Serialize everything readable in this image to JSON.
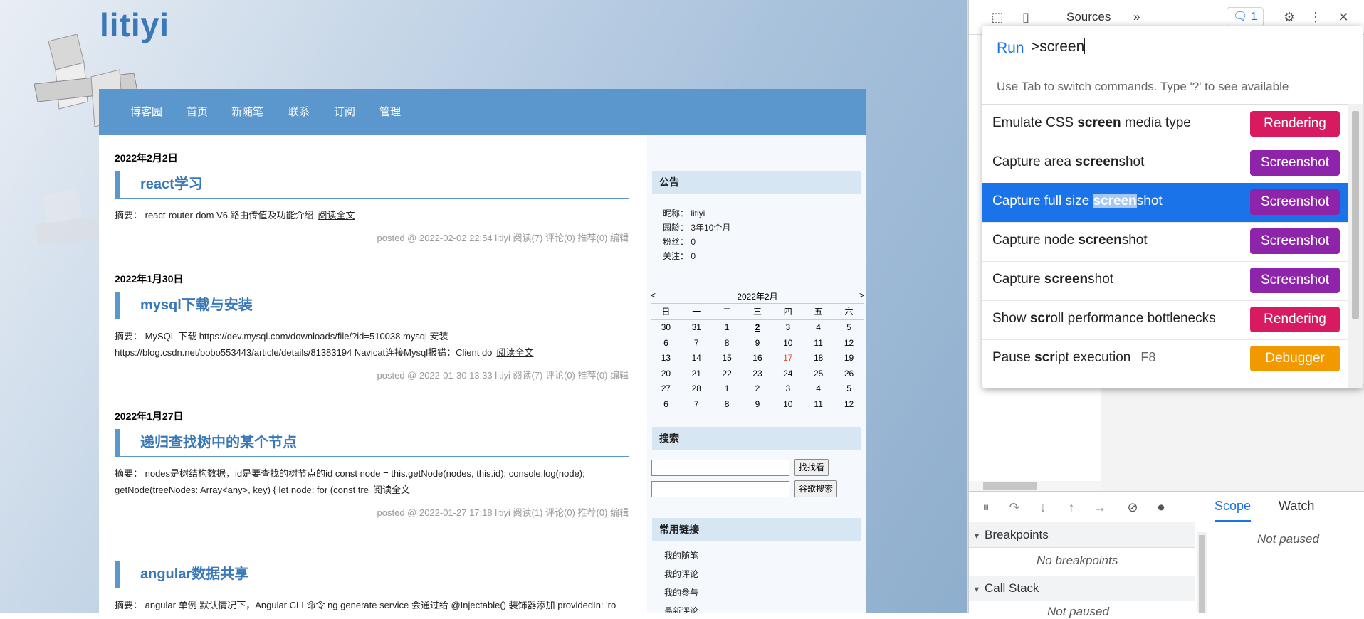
{
  "blog": {
    "title": "litiyi",
    "nav": [
      "博客园",
      "首页",
      "新随笔",
      "联系",
      "订阅",
      "管理"
    ],
    "posts": [
      {
        "date": "2022年2月2日",
        "title": "react学习",
        "summary": "摘要： react-router-dom V6 路由传值及功能介绍",
        "more": "阅读全文",
        "footer": "posted @ 2022-02-02 22:54 litiyi 阅读(7) 评论(0) 推荐(0) 编辑"
      },
      {
        "date": "2022年1月30日",
        "title": "mysql下载与安装",
        "summary": "摘要： MySQL 下载 https://dev.mysql.com/downloads/file/?id=510038 mysql 安装 https://blog.csdn.net/bobo553443/article/details/81383194 Navicat连接Mysql报错：Client do",
        "more": "阅读全文",
        "footer": "posted @ 2022-01-30 13:33 litiyi 阅读(7) 评论(0) 推荐(0) 编辑"
      },
      {
        "date": "2022年1月27日",
        "title": "递归查找树中的某个节点",
        "summary": "摘要： nodes是树结构数据，id是要查找的树节点的id const node = this.getNode(nodes, this.id); console.log(node); getNode(treeNodes: Array<any>, key) { let node; for (const tre",
        "more": "阅读全文",
        "footer": "posted @ 2022-01-27 17:18 litiyi 阅读(1) 评论(0) 推荐(0) 编辑"
      },
      {
        "date": "",
        "title": "angular数据共享",
        "summary": "摘要： angular 单例 默认情况下，Angular CLI 命令 ng generate service 会通过给 @Injectable() 装饰器添加 providedIn: 'ro",
        "more": "",
        "footer": ""
      }
    ],
    "sidebar": {
      "notice_title": "公告",
      "notice": [
        "昵称： litiyi",
        "园龄： 3年10个月",
        "粉丝： 0",
        "关注： 0"
      ],
      "calendar": {
        "prev": "<",
        "next": ">",
        "month": "2022年2月",
        "weekdays": [
          "日",
          "一",
          "二",
          "三",
          "四",
          "五",
          "六"
        ],
        "weeks": [
          [
            "30",
            "31",
            "1",
            "2",
            "3",
            "4",
            "5"
          ],
          [
            "6",
            "7",
            "8",
            "9",
            "10",
            "11",
            "12"
          ],
          [
            "13",
            "14",
            "15",
            "16",
            "17",
            "18",
            "19"
          ],
          [
            "20",
            "21",
            "22",
            "23",
            "24",
            "25",
            "26"
          ],
          [
            "27",
            "28",
            "1",
            "2",
            "3",
            "4",
            "5"
          ],
          [
            "6",
            "7",
            "8",
            "9",
            "10",
            "11",
            "12"
          ]
        ]
      },
      "search_title": "搜索",
      "search_button": "找找看",
      "google_button": "谷歌搜索",
      "links_title": "常用链接",
      "links": [
        "我的随笔",
        "我的评论",
        "我的参与",
        "最新评论"
      ]
    }
  },
  "devtools": {
    "tab": "Sources",
    "more_tabs": "»",
    "issues_count": "1",
    "command_menu": {
      "prefix": "Run",
      "query": ">screen",
      "hint": "Use Tab to switch commands. Type '?' to see available",
      "items": [
        {
          "pre": "Emulate CSS ",
          "bold": "screen",
          "post": " media type",
          "key": "",
          "category": "Rendering",
          "color": "#d81b60"
        },
        {
          "pre": "Capture area ",
          "bold": "screen",
          "post": "shot",
          "key": "",
          "category": "Screenshot",
          "color": "#8e24aa"
        },
        {
          "pre": "Capture full size ",
          "bold": "screen",
          "post": "shot",
          "key": "",
          "category": "Screenshot",
          "color": "#8e24aa"
        },
        {
          "pre": "Capture node ",
          "bold": "screen",
          "post": "shot",
          "key": "",
          "category": "Screenshot",
          "color": "#8e24aa"
        },
        {
          "pre": "Capture ",
          "bold": "screen",
          "post": "shot",
          "key": "",
          "category": "Screenshot",
          "color": "#8e24aa"
        },
        {
          "pre": "Show ",
          "bold": "scr",
          "post": "oll performance bottlenecks",
          "key": "",
          "category": "Rendering",
          "color": "#d81b60"
        },
        {
          "pre": "Pause ",
          "bold": "scr",
          "post": "ipt execution",
          "key": "F8",
          "category": "Debugger",
          "color": "#f29900"
        }
      ],
      "selected_index": 2
    },
    "debugger": {
      "scope_tab": "Scope",
      "watch_tab": "Watch",
      "breakpoints_title": "Breakpoints",
      "no_breakpoints": "No breakpoints",
      "callstack_title": "Call Stack",
      "not_paused": "Not paused",
      "not_paused_call": "Not paused"
    }
  }
}
